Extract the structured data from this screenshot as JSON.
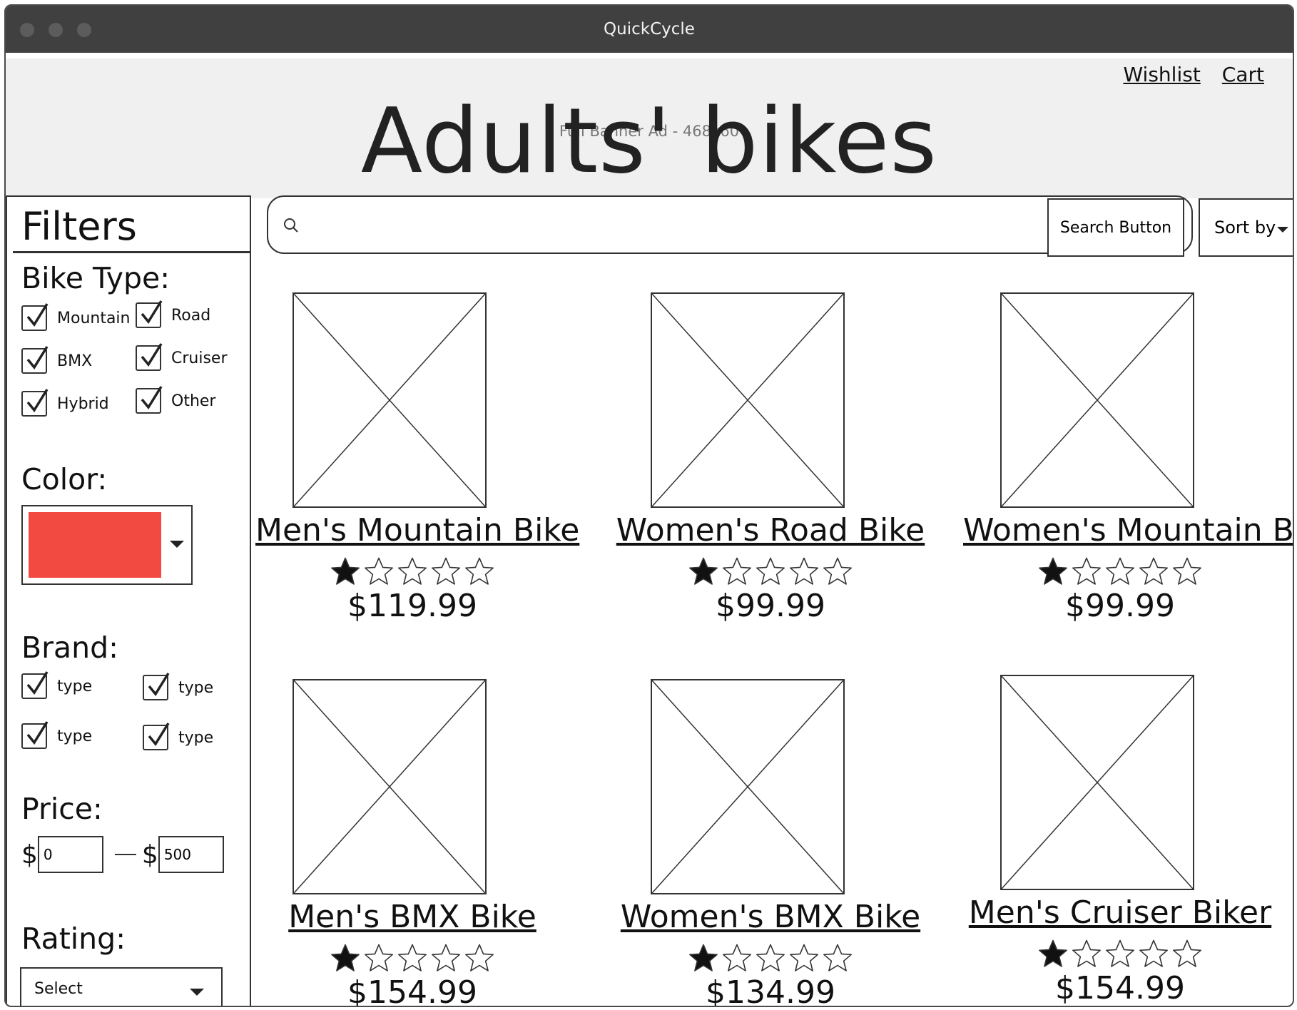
{
  "window": {
    "title": "QuickCycle"
  },
  "header": {
    "banner_text": "Full Banner Ad - 468x60",
    "page_title": "Adults' bikes",
    "links": {
      "wishlist": "Wishlist",
      "cart": "Cart"
    }
  },
  "filters": {
    "title": "Filters",
    "bike_type": {
      "label": "Bike Type:",
      "options": [
        "Mountain",
        "Road",
        "BMX",
        "Cruiser",
        "Hybrid",
        "Other"
      ]
    },
    "color": {
      "label": "Color:",
      "selected_color": "#f24a40"
    },
    "brand": {
      "label": "Brand:",
      "options": [
        "type",
        "type",
        "type",
        "type"
      ]
    },
    "price": {
      "label": "Price:",
      "currency": "$",
      "min": "0",
      "max": "500"
    },
    "rating": {
      "label": "Rating:",
      "selected": "Select"
    }
  },
  "search": {
    "placeholder": "",
    "button_label": "Search Button"
  },
  "sort": {
    "label": "Sort by"
  },
  "products": [
    {
      "name": "Men's Mountain Bike",
      "price": "$119.99",
      "rating": 1,
      "max_rating": 5
    },
    {
      "name": "Women's Road Bike",
      "price": "$99.99",
      "rating": 1,
      "max_rating": 5
    },
    {
      "name": "Women's Mountain Bike",
      "price": "$99.99",
      "rating": 1,
      "max_rating": 5
    },
    {
      "name": "Men's BMX Bike",
      "price": "$154.99",
      "rating": 1,
      "max_rating": 5
    },
    {
      "name": "Women's BMX Bike",
      "price": "$134.99",
      "rating": 1,
      "max_rating": 5
    },
    {
      "name": "Men's Cruiser Biker",
      "price": "$154.99",
      "rating": 1,
      "max_rating": 5
    }
  ],
  "icons": {
    "search": "search-icon",
    "caret": "caret-down-icon",
    "check": "check-icon",
    "star": "star-icon"
  }
}
